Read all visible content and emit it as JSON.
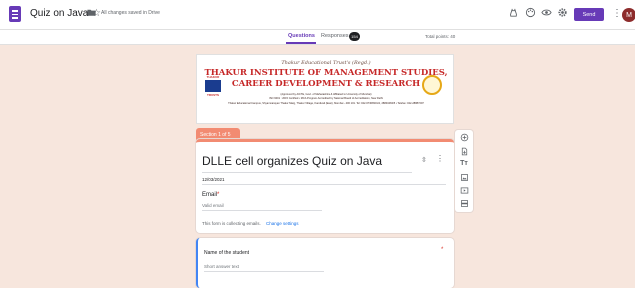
{
  "topbar": {
    "title": "Quiz on Java",
    "saved_status": "All changes saved in Drive",
    "send_label": "Send",
    "avatar_initial": "M",
    "icons": [
      "drive-folder-icon",
      "star-icon",
      "customize-theme-icon",
      "palette-icon",
      "preview-eye-icon",
      "settings-gear-icon",
      "more-vert-icon"
    ]
  },
  "tabs": {
    "questions": "Questions",
    "responses": "Responses",
    "responses_count": "154",
    "total_points": "Total points: 40"
  },
  "banner": {
    "trust_line": "Thakur Educational Trust's (Regd.)",
    "line1": "THAKUR INSTITUTE OF MANAGEMENT STUDIES,",
    "line2": "CAREER DEVELOPMENT & RESEARCH",
    "small1": "(Approved by AICTE, Govt. of Maharashtra & Affiliated to University of Mumbai)",
    "small2": "ISO 9001 : 2015 Certified • MCA Program Accredited by National Board of Accreditation, New Delhi",
    "small3": "Thakur Educational Campus, Shyamnarayan Thakur Marg, Thakur Village, Kandivali (East), Mumbai - 400 101. Tel: 022-67308301/2, 28840484/5 • Telefax: 022-28887297",
    "logo_left_text_top": "THAKUR",
    "logo_left_text_bottom": "TRUSTS"
  },
  "section": {
    "label": "Section 1 of 5"
  },
  "form": {
    "title": "DLLE cell organizes Quiz on Java",
    "description": "12/03/2021",
    "email_label": "Email",
    "required_mark": "*",
    "email_placeholder": "Valid email",
    "collect_note": "This form is collecting emails.",
    "change_settings": "Change settings"
  },
  "question1": {
    "label": "Name of the student",
    "required_mark": "*",
    "placeholder": "Short answer text"
  },
  "float_toolbar": {
    "icons": [
      "add-question-icon",
      "import-questions-icon",
      "add-title-icon",
      "add-image-icon",
      "add-video-icon",
      "add-section-icon"
    ]
  },
  "colors": {
    "accent": "#673ab7",
    "section": "#f28b72",
    "background": "#f7e6dd"
  }
}
